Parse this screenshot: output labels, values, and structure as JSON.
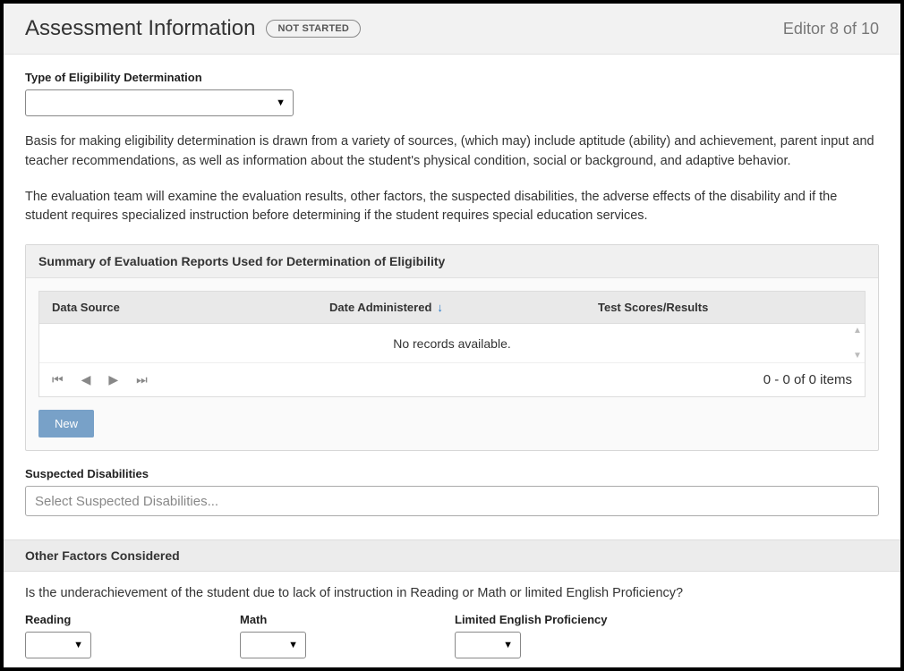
{
  "header": {
    "title": "Assessment Information",
    "status": "NOT STARTED",
    "editor_counter": "Editor 8 of 10"
  },
  "type_field": {
    "label": "Type of Eligibility Determination",
    "value": ""
  },
  "paragraph1": "Basis for making eligibility determination is drawn from a variety of sources, (which may) include aptitude (ability) and achievement, parent input and teacher recommendations, as well as information about the student's physical condition, social or background, and adaptive behavior.",
  "paragraph2": "The evaluation team will examine the evaluation results, other factors, the suspected disabilities, the adverse effects of the disability and if the student requires specialized instruction before determining if the student requires special education services.",
  "panel": {
    "title": "Summary of Evaluation Reports Used for Determination of Eligibility",
    "columns": {
      "data_source": "Data Source",
      "date_administered": "Date Administered",
      "test_scores": "Test Scores/Results"
    },
    "empty": "No records available.",
    "items_count": "0 - 0 of 0 items",
    "new_button": "New"
  },
  "suspected": {
    "label": "Suspected Disabilities",
    "placeholder": "Select Suspected Disabilities..."
  },
  "other_factors": {
    "header": "Other Factors Considered",
    "question": "Is the underachievement of the student due to lack of instruction in Reading or Math or limited English Proficiency?",
    "reading_label": "Reading",
    "math_label": "Math",
    "lep_label": "Limited English Proficiency"
  }
}
